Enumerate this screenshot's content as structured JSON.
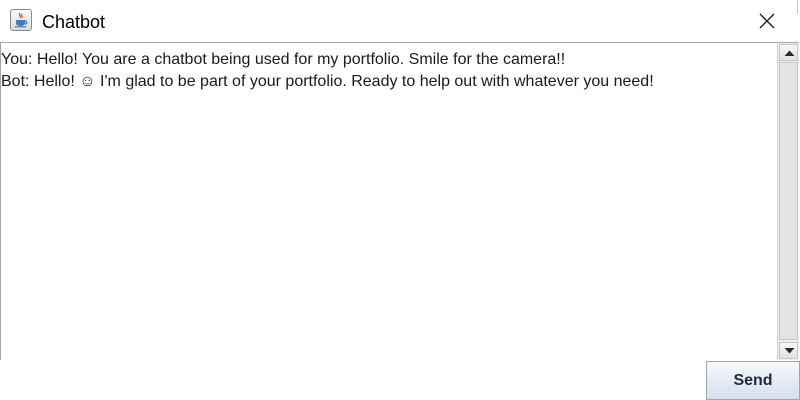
{
  "window": {
    "title": "Chatbot",
    "app_icon": "java-cup-icon",
    "close_icon": "close-icon"
  },
  "chat": {
    "messages": [
      {
        "speaker": "You",
        "text": "You: Hello! You are a chatbot being used for my portfolio. Smile for the camera!!"
      },
      {
        "speaker": "Bot",
        "text": "Bot: Hello! ☺ I'm glad to be part of your portfolio. Ready to help out with whatever you need!"
      }
    ]
  },
  "scrollbar": {
    "up_icon": "arrow-up-icon",
    "down_icon": "arrow-down-icon"
  },
  "actions": {
    "send_label": "Send"
  }
}
